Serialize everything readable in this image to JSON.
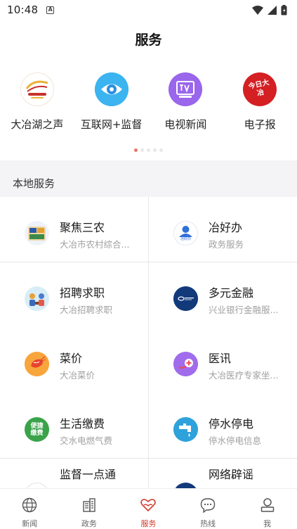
{
  "status_bar": {
    "time": "10:48",
    "notification_badge": "A"
  },
  "page_title": "服务",
  "top_services": [
    {
      "label": "大冶湖之声",
      "icon": "radio-logo-icon"
    },
    {
      "label": "互联网+监督",
      "icon": "eye-icon"
    },
    {
      "label": "电视新闻",
      "icon": "tv-news-icon"
    },
    {
      "label": "电子报",
      "icon": "newspaper-icon",
      "logo_text": "今日大冶"
    }
  ],
  "carousel": {
    "pages": 5,
    "active_index": 0
  },
  "section_title": "本地服务",
  "local_services": [
    {
      "title": "聚焦三农",
      "subtitle": "大冶市农村综合...",
      "icon": "agriculture-icon"
    },
    {
      "title": "冶好办",
      "subtitle": "政务服务",
      "icon": "gov-service-icon",
      "logo_text": "冶好办"
    },
    {
      "title": "招聘求职",
      "subtitle": "大冶招聘求职",
      "icon": "recruit-icon"
    },
    {
      "title": "多元金融",
      "subtitle": "兴业银行金融服...",
      "icon": "bank-icon"
    },
    {
      "title": "菜价",
      "subtitle": "大冶菜价",
      "icon": "shrimp-icon"
    },
    {
      "title": "医讯",
      "subtitle": "大冶医疗专家坐...",
      "icon": "medical-icon"
    },
    {
      "title": "生活缴费",
      "subtitle": "交水电燃气费",
      "icon": "bill-pay-icon",
      "logo_text": "便捷缴费"
    },
    {
      "title": "停水停电",
      "subtitle": "停水停电信息",
      "icon": "water-tap-icon"
    },
    {
      "title": "监督一点通",
      "subtitle": "",
      "icon": "supervise-icon"
    },
    {
      "title": "网络辟谣",
      "subtitle": "",
      "icon": "rumor-icon"
    }
  ],
  "bottom_nav": [
    {
      "label": "新闻",
      "icon": "globe-icon"
    },
    {
      "label": "政务",
      "icon": "building-icon"
    },
    {
      "label": "服务",
      "icon": "heart-hands-icon",
      "active": true
    },
    {
      "label": "热线",
      "icon": "chat-bubble-icon"
    },
    {
      "label": "我",
      "icon": "user-icon"
    }
  ],
  "colors": {
    "accent": "#d23a2c",
    "section_bg": "#f4f4f6",
    "divider": "#e6e6e6"
  }
}
